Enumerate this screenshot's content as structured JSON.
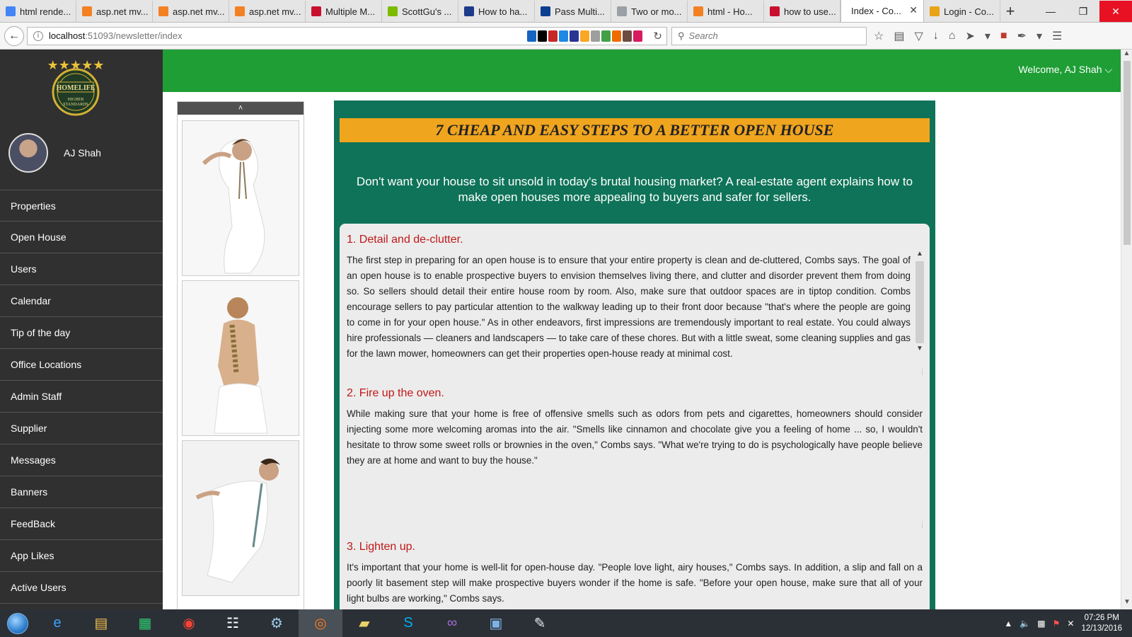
{
  "browser": {
    "tabs": [
      {
        "label": "html rende...",
        "color": "#4285f4"
      },
      {
        "label": "asp.net mv...",
        "color": "#f48024"
      },
      {
        "label": "asp.net mv...",
        "color": "#f48024"
      },
      {
        "label": "asp.net mv...",
        "color": "#f48024"
      },
      {
        "label": "Multiple M...",
        "color": "#c8102e"
      },
      {
        "label": "ScottGu's ...",
        "color": "#7cbb00"
      },
      {
        "label": "How to ha...",
        "color": "#1e3a8a"
      },
      {
        "label": "Pass Multi...",
        "color": "#0b3d91"
      },
      {
        "label": "Two or mo...",
        "color": "#9aa0a6"
      },
      {
        "label": "html - Ho...",
        "color": "#f48024"
      },
      {
        "label": "how to use...",
        "color": "#c8102e"
      },
      {
        "label": "Index - Co...",
        "color": "#ffffff"
      },
      {
        "label": "Login - Co...",
        "color": "#e8a317"
      }
    ],
    "active_tab_index": 11,
    "url_host": "localhost",
    "url_path": ":51093/newsletter/index",
    "search_placeholder": "Search",
    "addon_colors": [
      "#1565c0",
      "#000000",
      "#c62828",
      "#1e88e5",
      "#283593",
      "#f9a825",
      "#9e9e9e",
      "#43a047",
      "#ef6c00",
      "#6d4c41",
      "#d81b60"
    ]
  },
  "sidebar": {
    "logo_text": "HOMELIFE",
    "logo_subtext": "HIGHER STANDARDS",
    "user_name": "AJ Shah",
    "menu": [
      "Properties",
      "Open House",
      "Users",
      "Calendar",
      "Tip of the day",
      "Office Locations",
      "Admin Staff",
      "Supplier",
      "Messages",
      "Banners",
      "FeedBack",
      "App Likes",
      "Active Users"
    ]
  },
  "header": {
    "welcome_text": "Welcome, AJ Shah ⌵",
    "accent": "#1e9e35"
  },
  "gallery": {
    "up_arrow": "˄"
  },
  "newsletter": {
    "headline": "7 CHEAP AND EASY STEPS TO A BETTER OPEN HOUSE",
    "intro": "Don't want your house to sit unsold in today's brutal housing market? A real-estate agent explains how to make open houses more appealing to buyers and safer for sellers.",
    "steps": [
      {
        "title": "1. Detail and de-clutter.",
        "text": "The first step in preparing for an open house is to ensure that your entire property is clean and de-cluttered, Combs says. The goal of an open house is to enable prospective buyers to envision themselves living there, and clutter and disorder prevent them from doing so. So sellers should detail their entire house room by room. Also, make sure that outdoor spaces are in tiptop condition. Combs encourage sellers to pay particular attention to the walkway leading up to their front door because \"that's where the people are going to come in for your open house.\" As in other endeavors, first impressions are tremendously important to real estate. You could always hire professionals — cleaners and landscapers — to take care of these chores. But with a little sweat, some cleaning supplies and gas for the lawn mower, homeowners can get their properties open-house ready at minimal cost."
      },
      {
        "title": "2. Fire up the oven.",
        "text": "While making sure that your home is free of offensive smells such as odors from pets and cigarettes, homeowners should consider injecting some more welcoming aromas into the air. \"Smells like cinnamon and chocolate give you a feeling of home ... so, I wouldn't hesitate to throw some sweet rolls or brownies in the oven,\" Combs says. \"What we're trying to do is psychologically have people believe they are at home and want to buy the house.\""
      },
      {
        "title": "3. Lighten up.",
        "text": "It's important that your home is well-lit for open-house day. \"People love light, airy houses,\" Combs says. In addition, a slip and fall on a poorly lit basement step will make prospective buyers wonder if the home is safe. \"Before your open house, make sure that all of your light bulbs are working,\" Combs says."
      }
    ]
  },
  "taskbar": {
    "apps": [
      "ie",
      "explorer",
      "store",
      "chrome",
      "apps",
      "tool",
      "firefox",
      "folder",
      "skype",
      "visual-studio",
      "remote",
      "paint"
    ],
    "active_app_index": 6,
    "time": "07:26 PM",
    "date": "12/13/2016"
  }
}
